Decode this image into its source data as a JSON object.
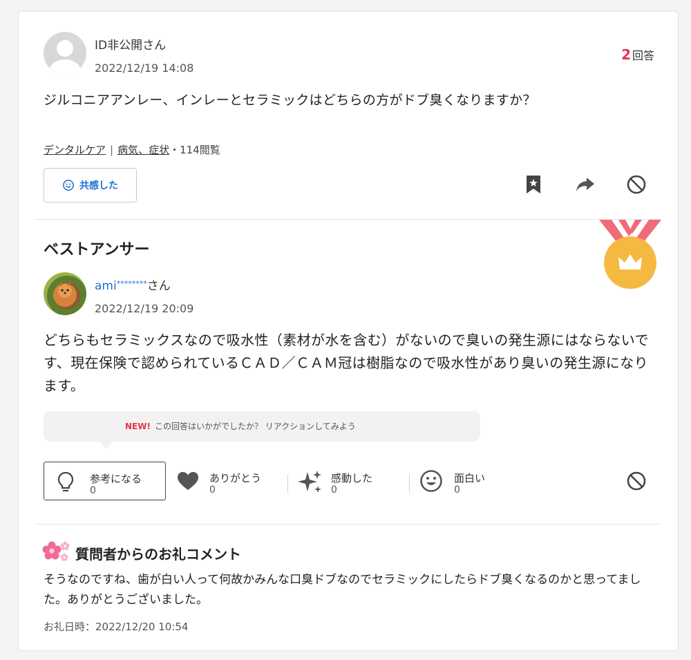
{
  "question": {
    "user_name": "ID非公開さん",
    "date": "2022/12/19 14:08",
    "answer_count_num": "2",
    "answer_count_label": "回答",
    "text": "ジルコニアアンレー、インレーとセラミックはどちらの方がドブ臭くなりますか？",
    "categories": [
      "デンタルケア",
      "病気、症状"
    ],
    "category_separator": "|",
    "views": "・114閲覧",
    "empathy_label": "共感した"
  },
  "best_answer": {
    "title": "ベストアンサー",
    "user_name_visible": "ami",
    "user_name_mask": "********",
    "user_name_suffix": "さん",
    "date": "2022/12/19 20:09",
    "text": "どちらもセラミックスなので吸水性（素材が水を含む）がないので臭いの発生源にはならないです、現在保険で認められているＣＡＤ／ＣＡＭ冠は樹脂なので吸水性があり臭いの発生源になります。",
    "prompt_new": "NEW!",
    "prompt_text": "この回答はいかがでしたか？ リアクションしてみよう",
    "reactions": [
      {
        "label": "参考になる",
        "count": "0",
        "icon": "lightbulb-icon"
      },
      {
        "label": "ありがとう",
        "count": "0",
        "icon": "heart-icon"
      },
      {
        "label": "感動した",
        "count": "0",
        "icon": "sparkle-icon"
      },
      {
        "label": "面白い",
        "count": "0",
        "icon": "smile-icon"
      }
    ]
  },
  "thanks": {
    "title": "質問者からのお礼コメント",
    "text": "そうなのですね、歯が白い人って何故かみんな口臭ドブなのでセラミックにしたらドブ臭くなるのかと思ってました。ありがとうございました。",
    "date_label": "お礼日時：",
    "date": "2022/12/20 10:54"
  },
  "colors": {
    "accent_blue": "#1f6fd1",
    "accent_red": "#e8334a",
    "medal_gold": "#f5b942",
    "ribbon_pink": "#f06a7a"
  }
}
